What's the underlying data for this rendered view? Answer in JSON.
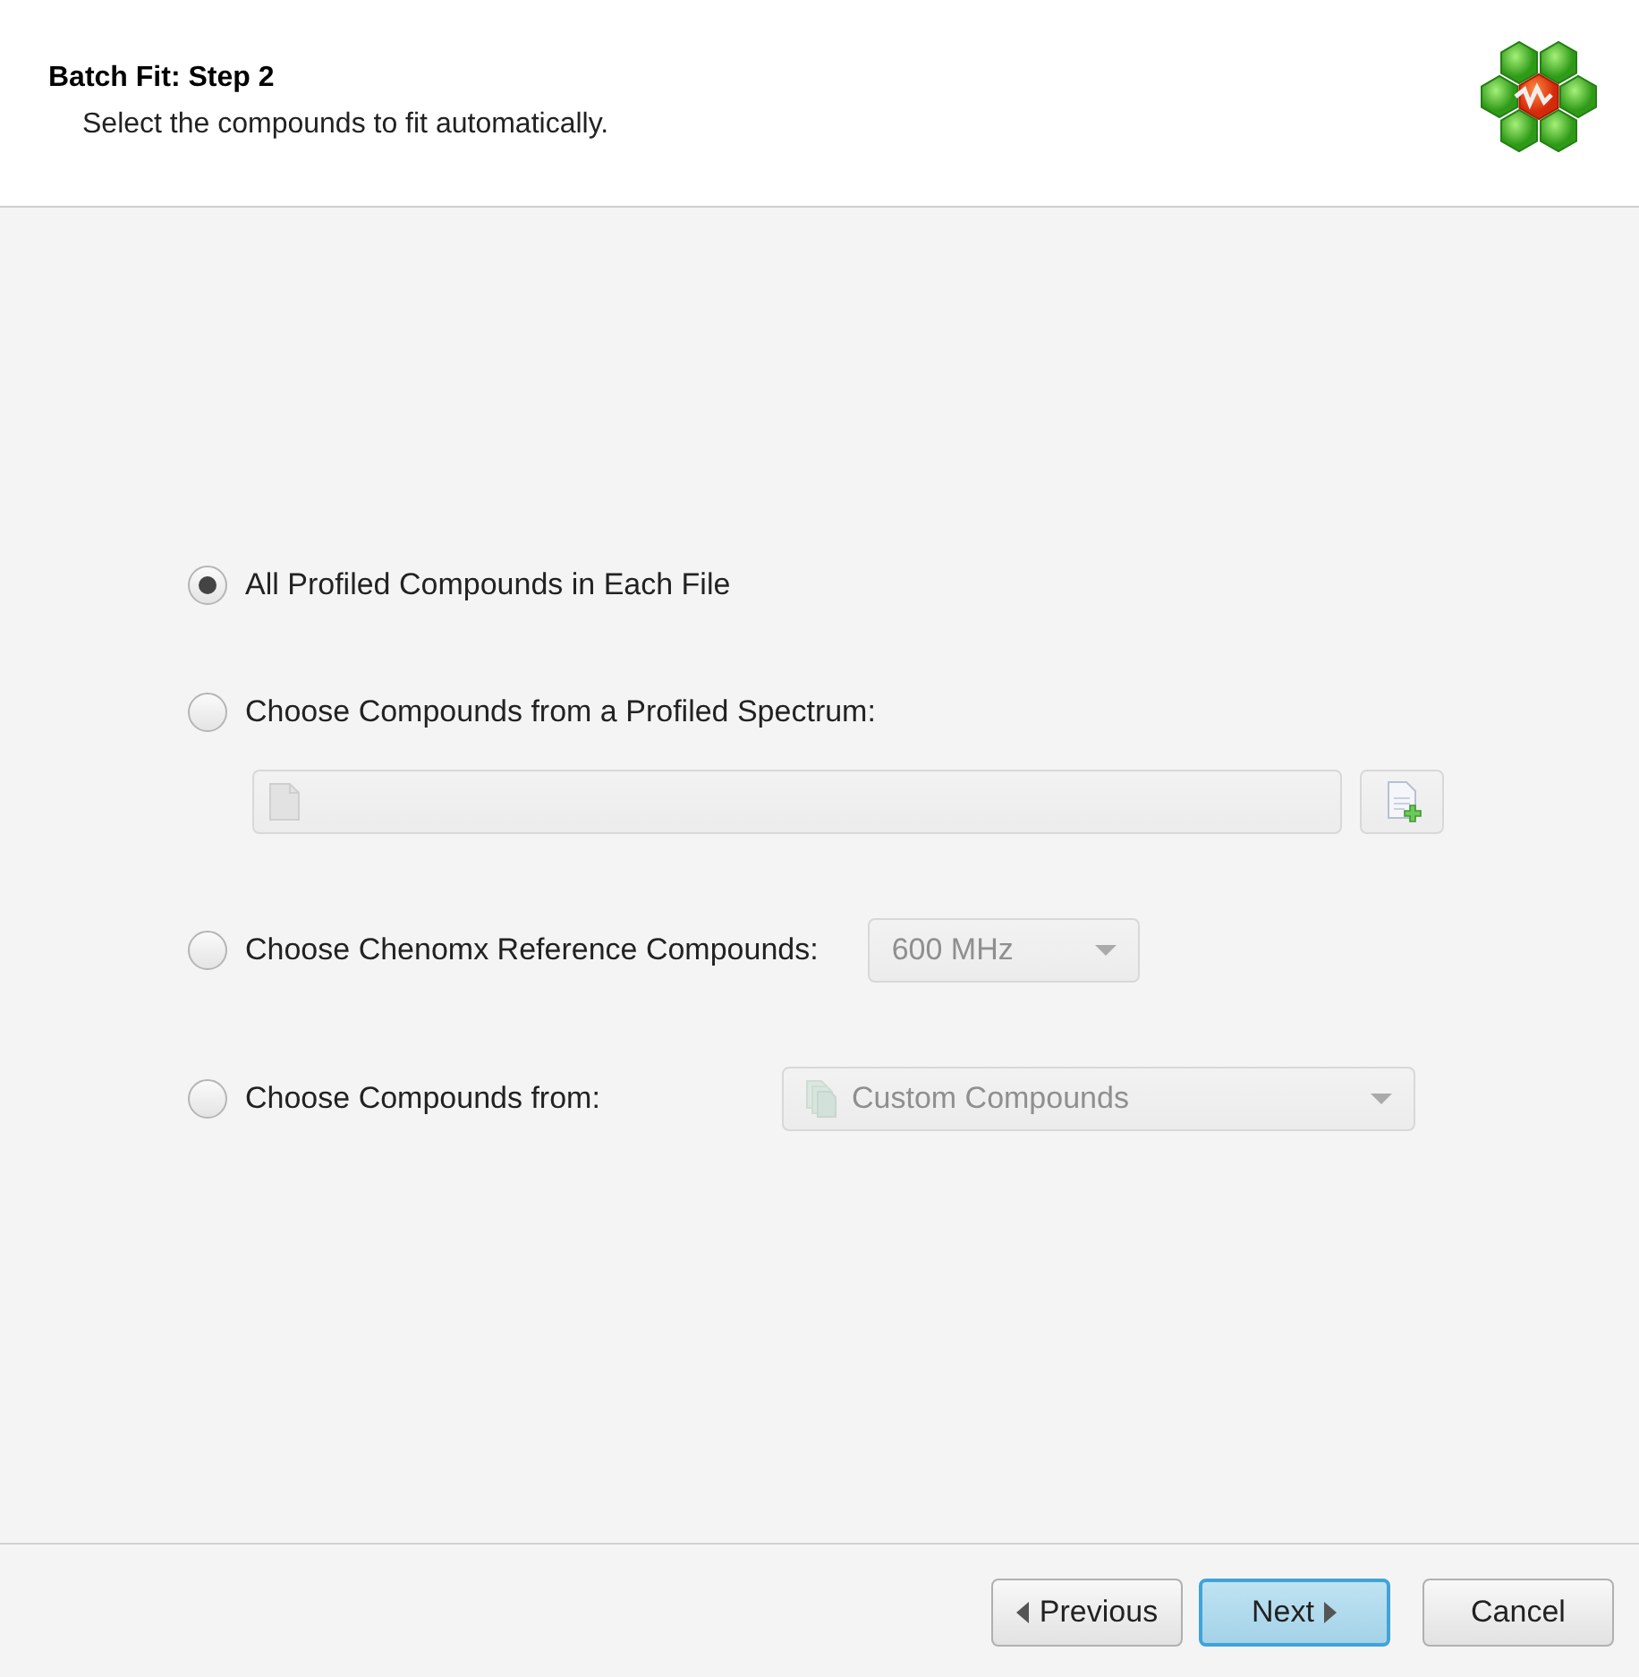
{
  "header": {
    "title": "Batch Fit: Step 2",
    "subtitle": "Select the compounds to fit automatically."
  },
  "options": [
    {
      "kind": "plain",
      "label": "All Profiled Compounds in Each File",
      "selected": true
    },
    {
      "kind": "file",
      "label": "Choose Compounds from a Profiled Spectrum:",
      "selected": false,
      "field": {
        "disabled": true
      },
      "add_button": {
        "disabled": true
      }
    },
    {
      "kind": "reference",
      "label": "Choose Chenomx Reference Compounds:",
      "selected": false,
      "dropdown": {
        "value": "600 MHz",
        "disabled": true
      }
    },
    {
      "kind": "library",
      "label": "Choose Compounds from:",
      "selected": false,
      "dropdown": {
        "value": "Custom Compounds",
        "disabled": true
      }
    }
  ],
  "buttons": [
    {
      "kind": "previous",
      "label": "Previous",
      "default": false
    },
    {
      "kind": "next",
      "label": "Next",
      "default": true
    },
    {
      "kind": "cancel",
      "label": "Cancel",
      "default": false
    }
  ]
}
